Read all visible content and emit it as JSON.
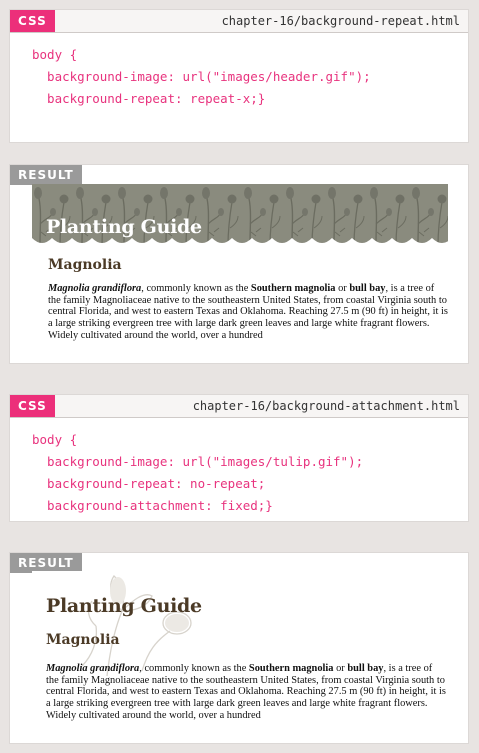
{
  "panel1": {
    "tag": "CSS",
    "filename": "chapter-16/background-repeat.html",
    "code_lines": [
      "body {",
      "  background-image: url(\"images/header.gif\");",
      "  background-repeat: repeat-x;}"
    ]
  },
  "panel2": {
    "tag": "RESULT",
    "page_title": "Planting Guide",
    "heading": "Magnolia",
    "para_name": "Magnolia grandiflora",
    "para_t1": ", commonly known as the ",
    "para_b1": "Southern magnolia",
    "para_t2": " or ",
    "para_b2": "bull bay",
    "para_t3": ", is a tree of the family Magnoliaceae native to the southeastern United States, from coastal Virginia south to central Florida, and west to eastern Texas and Oklahoma. Reaching 27.5 m (90 ft) in height, it is a large striking evergreen tree with large dark green leaves and large white fragrant flowers. Widely cultivated around the world, over a hundred"
  },
  "panel3": {
    "tag": "CSS",
    "filename": "chapter-16/background-attachment.html",
    "code_lines": [
      "body {",
      "  background-image: url(\"images/tulip.gif\");",
      "  background-repeat: no-repeat;",
      "  background-attachment: fixed;}"
    ]
  },
  "panel4": {
    "tag": "RESULT",
    "page_title": "Planting Guide",
    "heading": "Magnolia",
    "para_name": "Magnolia grandiflora",
    "para_t1": ", commonly known as the ",
    "para_b1": "Southern magnolia",
    "para_t2": " or ",
    "para_b2": "bull bay",
    "para_t3": ", is a tree of the family Magnoliaceae native to the southeastern United States, from coastal Virginia south to central Florida, and west to eastern Texas and Oklahoma. Reaching 27.5 m (90 ft) in height, it is a large striking evergreen tree with large dark green leaves and large white fragrant flowers. Widely cultivated around the world, over a hundred"
  },
  "colors": {
    "css_tag": "#ec2f7a",
    "result_tag": "#9a9a9a",
    "code_text": "#e8337e",
    "banner": "#8a8b7e",
    "heading": "#4b3a26"
  }
}
